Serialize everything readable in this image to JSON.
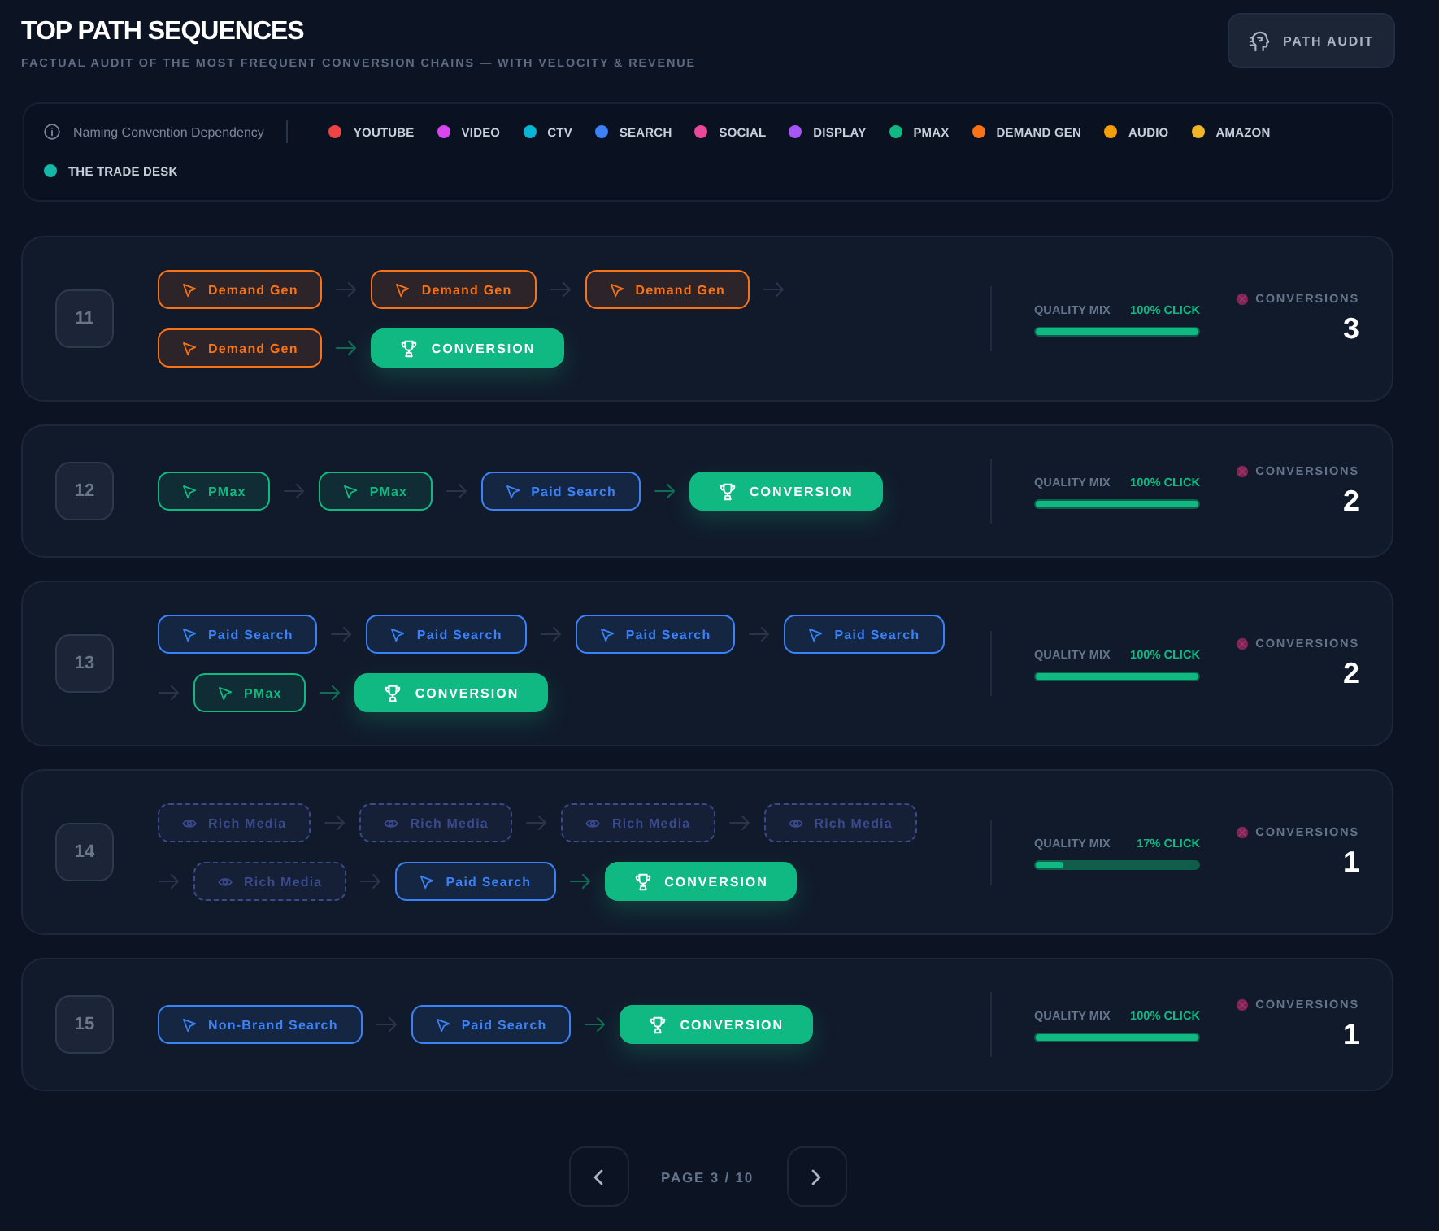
{
  "header": {
    "title": "TOP PATH SEQUENCES",
    "subtitle": "FACTUAL AUDIT OF THE MOST FREQUENT CONVERSION CHAINS — WITH VELOCITY & REVENUE"
  },
  "audit_button": {
    "label": "PATH AUDIT"
  },
  "legend": {
    "note": "Naming Convention Dependency",
    "channels": [
      {
        "label": "YOUTUBE",
        "color": "#ef4444"
      },
      {
        "label": "VIDEO",
        "color": "#d946ef"
      },
      {
        "label": "CTV",
        "color": "#06b6d4"
      },
      {
        "label": "SEARCH",
        "color": "#3b82f6"
      },
      {
        "label": "SOCIAL",
        "color": "#ec4899"
      },
      {
        "label": "DISPLAY",
        "color": "#a855f7"
      },
      {
        "label": "PMAX",
        "color": "#10b981"
      },
      {
        "label": "DEMAND GEN",
        "color": "#f97316"
      },
      {
        "label": "AUDIO",
        "color": "#f59e0b"
      },
      {
        "label": "AMAZON",
        "color": "#f0b429"
      },
      {
        "label": "THE TRADE DESK",
        "color": "#14b8a6"
      }
    ]
  },
  "paths": [
    {
      "rank": "11",
      "steps": [
        {
          "kind": "click",
          "label": "Demand Gen",
          "color": "#f97316"
        },
        {
          "kind": "click",
          "label": "Demand Gen",
          "color": "#f97316"
        },
        {
          "kind": "click",
          "label": "Demand Gen",
          "color": "#f97316"
        },
        {
          "kind": "click",
          "label": "Demand Gen",
          "color": "#f97316"
        },
        {
          "kind": "conversion",
          "label": "CONVERSION"
        }
      ],
      "quality_label": "QUALITY MIX",
      "quality_value": "100% CLICK",
      "level": 1,
      "conversions_label": "CONVERSIONS",
      "conversions": "3"
    },
    {
      "rank": "12",
      "steps": [
        {
          "kind": "click",
          "label": "PMax",
          "color": "#10b981"
        },
        {
          "kind": "click",
          "label": "PMax",
          "color": "#10b981"
        },
        {
          "kind": "click",
          "label": "Paid Search",
          "color": "#3b82f6"
        },
        {
          "kind": "conversion",
          "label": "CONVERSION"
        }
      ],
      "quality_label": "QUALITY MIX",
      "quality_value": "100% CLICK",
      "level": 1,
      "conversions_label": "CONVERSIONS",
      "conversions": "2"
    },
    {
      "rank": "13",
      "steps": [
        {
          "kind": "click",
          "label": "Paid Search",
          "color": "#3b82f6"
        },
        {
          "kind": "click",
          "label": "Paid Search",
          "color": "#3b82f6"
        },
        {
          "kind": "click",
          "label": "Paid Search",
          "color": "#3b82f6"
        },
        {
          "kind": "click",
          "label": "Paid Search",
          "color": "#3b82f6"
        },
        {
          "kind": "click",
          "label": "PMax",
          "color": "#10b981"
        },
        {
          "kind": "conversion",
          "label": "CONVERSION"
        }
      ],
      "quality_label": "QUALITY MIX",
      "quality_value": "100% CLICK",
      "level": 1,
      "conversions_label": "CONVERSIONS",
      "conversions": "2"
    },
    {
      "rank": "14",
      "steps": [
        {
          "kind": "view",
          "label": "Rich Media",
          "color": "#3b4a8c"
        },
        {
          "kind": "view",
          "label": "Rich Media",
          "color": "#3b4a8c"
        },
        {
          "kind": "view",
          "label": "Rich Media",
          "color": "#3b4a8c"
        },
        {
          "kind": "view",
          "label": "Rich Media",
          "color": "#3b4a8c"
        },
        {
          "kind": "view",
          "label": "Rich Media",
          "color": "#3b4a8c"
        },
        {
          "kind": "click",
          "label": "Paid Search",
          "color": "#3b82f6"
        },
        {
          "kind": "conversion",
          "label": "CONVERSION"
        }
      ],
      "quality_label": "QUALITY MIX",
      "quality_value": "17% CLICK",
      "level": 0.17,
      "conversions_label": "CONVERSIONS",
      "conversions": "1"
    },
    {
      "rank": "15",
      "steps": [
        {
          "kind": "click",
          "label": "Non-Brand Search",
          "color": "#3b82f6"
        },
        {
          "kind": "click",
          "label": "Paid Search",
          "color": "#3b82f6"
        },
        {
          "kind": "conversion",
          "label": "CONVERSION"
        }
      ],
      "quality_label": "QUALITY MIX",
      "quality_value": "100% CLICK",
      "level": 1,
      "conversions_label": "CONVERSIONS",
      "conversions": "1"
    }
  ],
  "pagination": {
    "label": "PAGE 3 / 10"
  }
}
